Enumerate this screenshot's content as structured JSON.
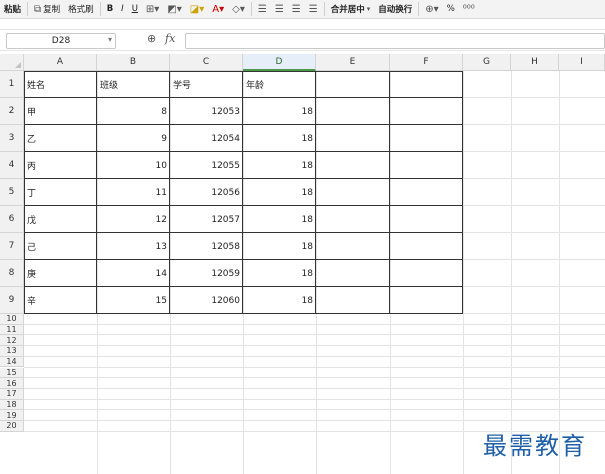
{
  "toolbar": {
    "paste": "粘贴",
    "copy": "复制",
    "format_painter": "格式刷",
    "bold": "B",
    "italic": "I",
    "underline": "U",
    "merge_center": "合并居中",
    "wrap_text": "自动换行",
    "percent": "%"
  },
  "formula_bar": {
    "name_box": "D28",
    "fx": "fx",
    "formula": ""
  },
  "columns": [
    "A",
    "B",
    "C",
    "D",
    "E",
    "F",
    "G",
    "H",
    "I"
  ],
  "selected_column": "D",
  "row_numbers": [
    "1",
    "2",
    "3",
    "4",
    "5",
    "6",
    "7",
    "8",
    "9",
    "10",
    "11",
    "12",
    "13",
    "14",
    "15",
    "16",
    "17",
    "18",
    "19",
    "20"
  ],
  "table": {
    "headers": [
      "姓名",
      "班级",
      "学号",
      "年龄"
    ],
    "rows": [
      [
        "甲",
        "8",
        "12053",
        "18"
      ],
      [
        "乙",
        "9",
        "12054",
        "18"
      ],
      [
        "丙",
        "10",
        "12055",
        "18"
      ],
      [
        "丁",
        "11",
        "12056",
        "18"
      ],
      [
        "戊",
        "12",
        "12057",
        "18"
      ],
      [
        "己",
        "13",
        "12058",
        "18"
      ],
      [
        "庚",
        "14",
        "12059",
        "18"
      ],
      [
        "辛",
        "15",
        "12060",
        "18"
      ]
    ]
  },
  "watermark": "最需教育"
}
